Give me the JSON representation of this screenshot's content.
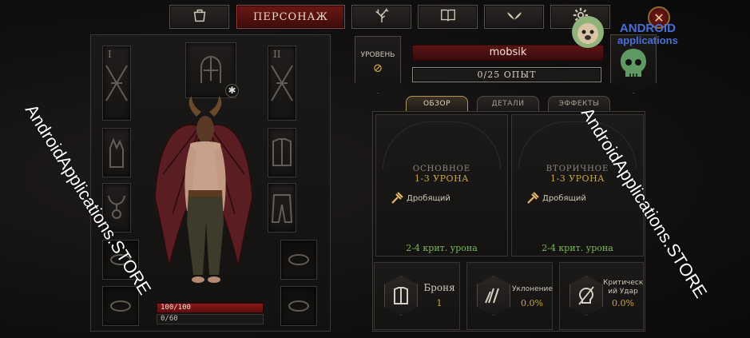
{
  "nav": {
    "items": [
      {
        "name": "inventory-tab",
        "icon": "bag-icon"
      },
      {
        "name": "character-tab",
        "label": "ПЕРСОНАЖ",
        "active": true
      },
      {
        "name": "skill-tree-tab",
        "icon": "tree-icon"
      },
      {
        "name": "codex-tab",
        "icon": "book-icon"
      },
      {
        "name": "paragon-tab",
        "icon": "wings-icon"
      },
      {
        "name": "settings-tab",
        "icon": "gear-icon"
      }
    ],
    "character_label": "ПЕРСОНАЖ",
    "close_icon": "close-icon"
  },
  "equipment": {
    "left_roman": "I",
    "right_roman": "II",
    "hp_text": "100/100",
    "mana_text": "0/60",
    "slots": [
      "helm",
      "main-hand",
      "off-hand",
      "gloves",
      "chest",
      "legs",
      "ring",
      "ring",
      "amulet",
      "boots"
    ]
  },
  "character": {
    "level_label": "УРОВЕНЬ",
    "level_value": "⊘",
    "name": "mobsik",
    "xp_text": "0/25 ОПЫТ"
  },
  "tabs": [
    {
      "label": "ОБЗОР",
      "active": true
    },
    {
      "label": "ДЕТАЛИ",
      "active": false
    },
    {
      "label": "ЭФФЕКТЫ",
      "active": false
    }
  ],
  "weapons": [
    {
      "title": "ОСНОВНОЕ",
      "damage": "1-3 УРОНА",
      "type": "Дробящий",
      "crit": "2-4 крит. урона"
    },
    {
      "title": "ВТОРИЧНОЕ",
      "damage": "1-3 УРОНА",
      "type": "Дробящий",
      "crit": "2-4 крит. урона"
    }
  ],
  "defense": [
    {
      "label": "Броня",
      "value": "1"
    },
    {
      "label": "Уклонение",
      "value": "0.0%"
    },
    {
      "label": "Критическ ий Удар",
      "value": "0.0%"
    }
  ],
  "watermark": {
    "left": "AndroidApplications.STORE",
    "right": "AndroidApplications.STORE",
    "logo_line1": "ANDROID",
    "logo_line2": "applications"
  },
  "colors": {
    "accent_red": "#6b1716",
    "gold": "#c9a640",
    "crit_green": "#78b85a"
  }
}
